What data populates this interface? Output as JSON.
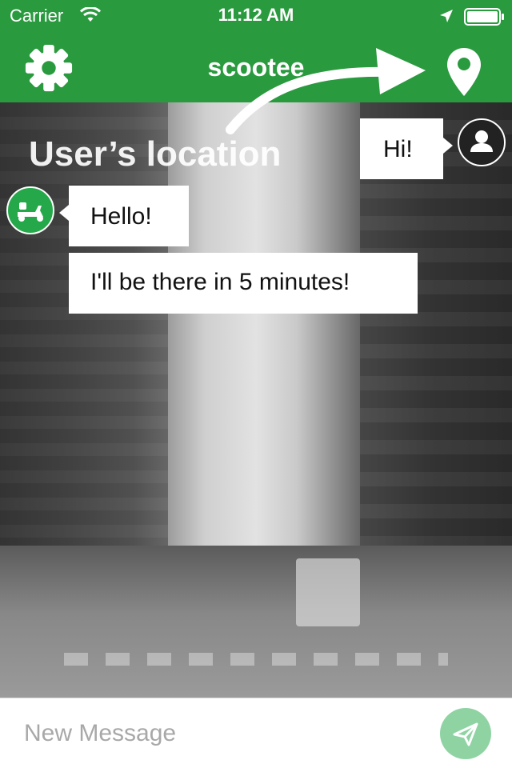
{
  "status_bar": {
    "carrier": "Carrier",
    "time": "11:12 AM"
  },
  "navbar": {
    "title": "scootee",
    "left_icon": "gear-icon",
    "right_icon": "location-pin-icon"
  },
  "map": {
    "location_label": "User’s location"
  },
  "chat": {
    "messages": [
      {
        "sender": "user",
        "text": "Hi!"
      },
      {
        "sender": "driver",
        "text": "Hello!"
      },
      {
        "sender": "driver",
        "text": "I'll be there in 5 minutes!"
      }
    ]
  },
  "composer": {
    "placeholder": "New Message",
    "value": "",
    "send_icon": "send-icon"
  },
  "colors": {
    "brand": "#2a9a3f",
    "send_button": "#8fd3a3",
    "scooter_avatar": "#25a84a"
  }
}
